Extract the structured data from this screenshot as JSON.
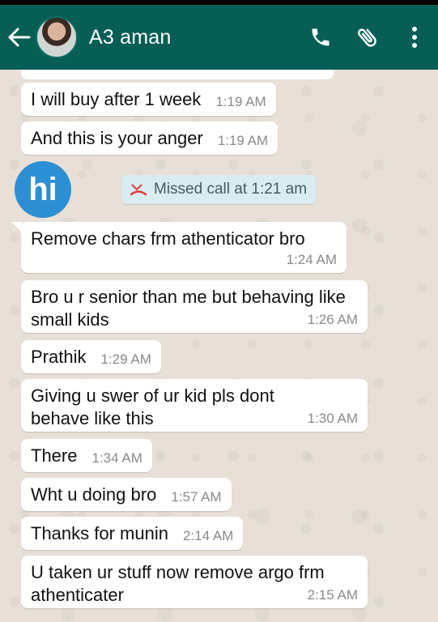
{
  "header": {
    "contact_name": "A3 aman",
    "icons": [
      "back-arrow-icon",
      "phone-icon",
      "paperclip-icon",
      "more-vert-icon"
    ],
    "background": "#075e54"
  },
  "chat": {
    "missed_call": "Missed call at 1:21 am",
    "logo_text": "hi",
    "messages": [
      {
        "text": "I will buy after 1 week",
        "time": "1:19 AM"
      },
      {
        "text": "And this is your anger",
        "time": "1:19 AM"
      },
      {
        "text": "Remove chars frm athenticator bro",
        "time": "1:24 AM"
      },
      {
        "text": "Bro u r senior than me but behaving like small kids",
        "time": "1:26 AM"
      },
      {
        "text": "Prathik",
        "time": "1:29 AM"
      },
      {
        "text": "Giving u swer of ur kid pls dont behave like this",
        "time": "1:30 AM"
      },
      {
        "text": "There",
        "time": "1:34 AM"
      },
      {
        "text": "Wht u doing bro",
        "time": "1:57 AM"
      },
      {
        "text": "Thanks for munin",
        "time": "2:14 AM"
      },
      {
        "text": "U taken ur stuff now remove argo frm athenticater",
        "time": "2:15 AM"
      }
    ]
  }
}
